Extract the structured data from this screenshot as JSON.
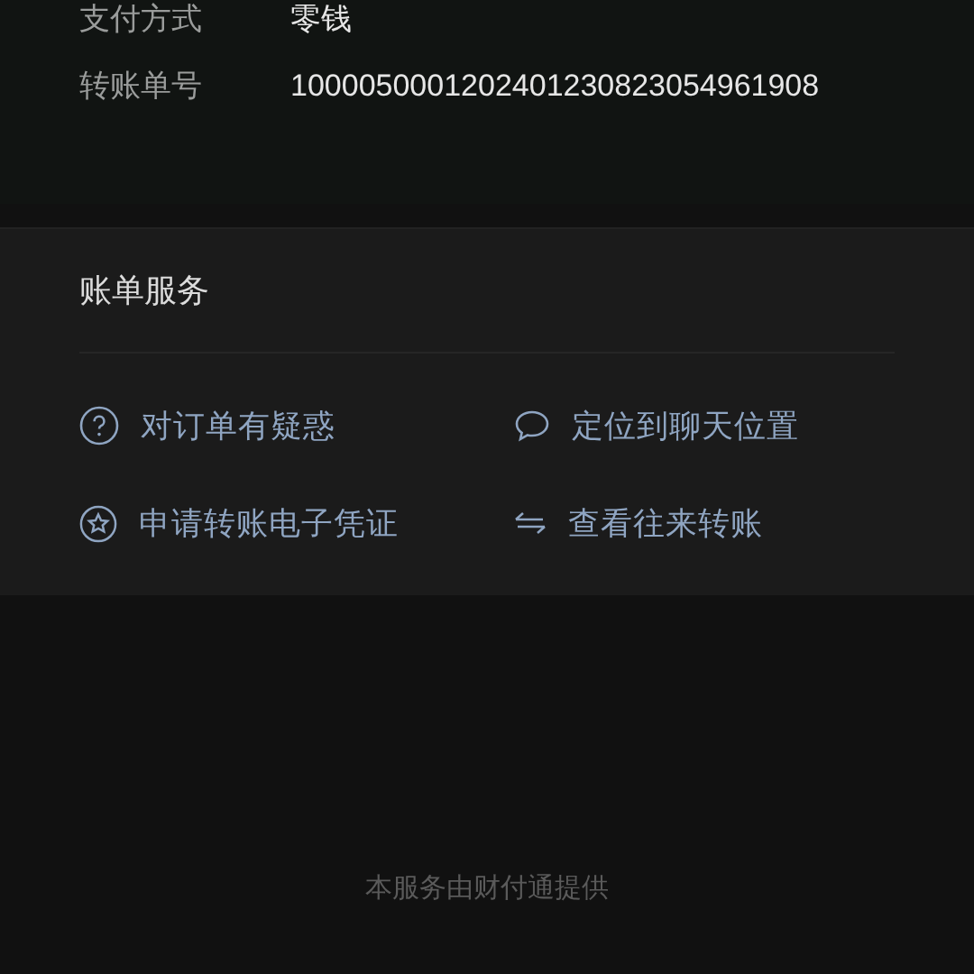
{
  "details": [
    {
      "label": "支付方式",
      "value": "零钱"
    },
    {
      "label": "转账单号",
      "value": "1000050001202401230823054961908"
    }
  ],
  "services": {
    "title": "账单服务",
    "items": [
      {
        "kind": "question",
        "label": "对订单有疑惑"
      },
      {
        "kind": "chat",
        "label": "定位到聊天位置"
      },
      {
        "kind": "voucher",
        "label": "申请转账电子凭证"
      },
      {
        "kind": "transfer",
        "label": "查看往来转账"
      }
    ]
  },
  "footer": "本服务由财付通提供"
}
